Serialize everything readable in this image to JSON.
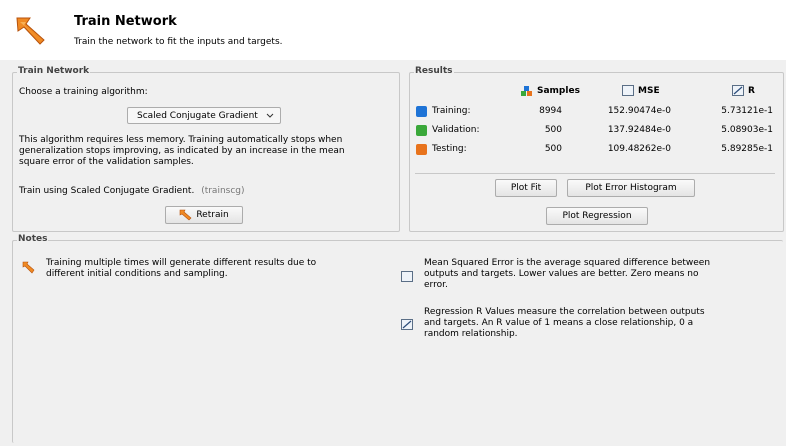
{
  "header": {
    "title": "Train Network",
    "subtitle": "Train the network to fit the inputs and targets."
  },
  "train_panel": {
    "legend": "Train Network",
    "choose_label": "Choose a training algorithm:",
    "algorithm_value": "Scaled Conjugate Gradient",
    "description": "This algorithm requires less memory. Training automatically stops when generalization stops improving, as indicated by an increase in the mean square error of the validation samples.",
    "train_using": "Train using Scaled Conjugate Gradient.",
    "train_fn": "(trainscg)",
    "retrain_label": "Retrain"
  },
  "results": {
    "legend": "Results",
    "headers": {
      "samples": "Samples",
      "mse": "MSE",
      "r": "R"
    },
    "rows": [
      {
        "label": "Training:",
        "samples": "8994",
        "mse": "152.90474e-0",
        "r": "5.73121e-1",
        "color": "#1e73d6"
      },
      {
        "label": "Validation:",
        "samples": "500",
        "mse": "137.92484e-0",
        "r": "5.08903e-1",
        "color": "#3aa83a"
      },
      {
        "label": "Testing:",
        "samples": "500",
        "mse": "109.48262e-0",
        "r": "5.89285e-1",
        "color": "#e8731c"
      }
    ],
    "plot_fit_label": "Plot Fit",
    "plot_error_histogram_label": "Plot Error Histogram",
    "plot_regression_label": "Plot Regression"
  },
  "notes": {
    "legend": "Notes",
    "training_note": "Training multiple times will generate different results due to different initial conditions and sampling.",
    "mse_note": "Mean Squared Error is the average squared difference between outputs and targets. Lower values are better. Zero means no error.",
    "r_note": "Regression R Values measure the correlation between outputs and targets. An R value of 1 means a close relationship, 0 a random relationship."
  }
}
